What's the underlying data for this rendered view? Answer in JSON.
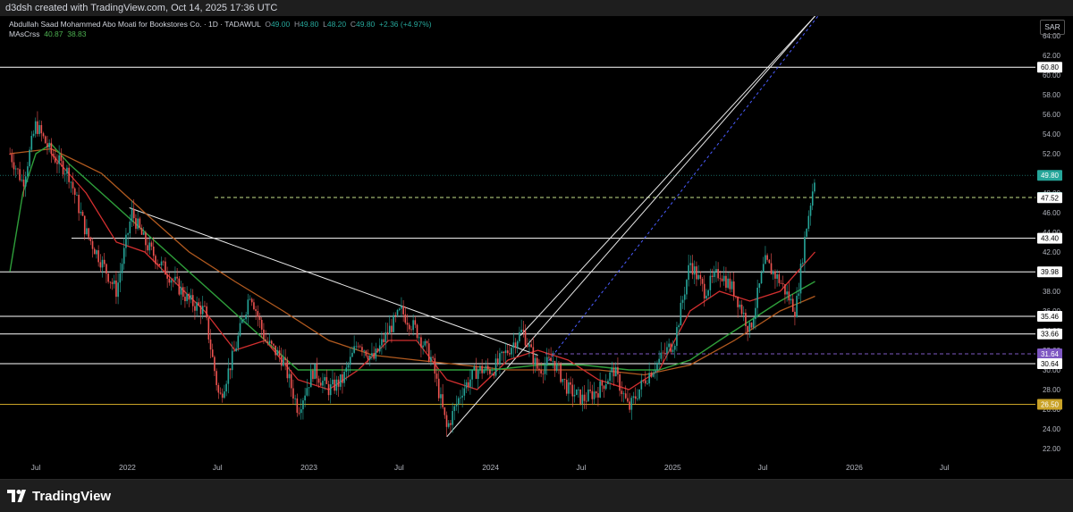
{
  "header": {
    "text": "d3dsh created with TradingView.com, Oct 14, 2025 17:36 UTC"
  },
  "symbol": {
    "name": "Abdullah Saad Mohammed Abo Moati for Bookstores Co. · 1D · TADAWUL",
    "open_label": "O",
    "open": "49.00",
    "high_label": "H",
    "high": "49.80",
    "low_label": "L",
    "low": "48.20",
    "close_label": "C",
    "close": "49.80",
    "change": "+2.36 (+4.97%)"
  },
  "indicator": {
    "name": "MAsCrss",
    "value1": "40.87",
    "value2": "38.83"
  },
  "currency": "SAR",
  "footer": {
    "brand": "TradingView"
  },
  "colors": {
    "up": "#26a69a",
    "down": "#ef5350",
    "ma_slow": "#b25a1f",
    "ma_red": "#d32f2f",
    "ma_green": "#2e9e3a",
    "level_line": "#ffffff",
    "purple": "#7e57c2",
    "yellow": "#c9a227",
    "teal": "#26a69a"
  },
  "chart_data": {
    "type": "line",
    "y_range": [
      21,
      66
    ],
    "y_ticks": [
      "22.00",
      "24.00",
      "26.00",
      "28.00",
      "30.00",
      "32.00",
      "34.00",
      "36.00",
      "38.00",
      "40.00",
      "42.00",
      "44.00",
      "46.00",
      "48.00",
      "50.00",
      "52.00",
      "54.00",
      "56.00",
      "58.00",
      "60.00",
      "62.00",
      "64.00"
    ],
    "x_ticks": [
      "Jul",
      "2022",
      "Jul",
      "2023",
      "Jul",
      "2024",
      "Jul",
      "2025",
      "Jul",
      "2026",
      "Jul"
    ],
    "price_series": {
      "name": "price",
      "x": [
        "2021-05-10",
        "2021-06-05",
        "2021-07-01",
        "2021-08-01",
        "2021-09-05",
        "2021-10-10",
        "2021-11-10",
        "2021-12-10",
        "2022-01-10",
        "2022-02-05",
        "2022-03-05",
        "2022-04-05",
        "2022-05-05",
        "2022-06-05",
        "2022-07-05",
        "2022-08-05",
        "2022-09-05",
        "2022-10-05",
        "2022-11-10",
        "2022-12-10",
        "2023-01-10",
        "2023-02-10",
        "2023-03-10",
        "2023-04-10",
        "2023-05-10",
        "2023-06-10",
        "2023-07-05",
        "2023-08-05",
        "2023-09-05",
        "2023-10-05",
        "2023-11-05",
        "2023-12-05",
        "2024-01-05",
        "2024-02-05",
        "2024-03-05",
        "2024-04-05",
        "2024-05-05",
        "2024-06-05",
        "2024-07-05",
        "2024-08-05",
        "2024-09-05",
        "2024-10-05",
        "2024-11-05",
        "2024-12-05",
        "2025-01-05",
        "2025-02-05",
        "2025-03-05",
        "2025-04-05",
        "2025-05-05",
        "2025-06-05",
        "2025-07-05",
        "2025-08-05",
        "2025-09-05",
        "2025-09-25",
        "2025-10-14"
      ],
      "y": [
        52,
        49,
        55,
        52,
        50,
        44,
        41,
        38,
        46,
        43,
        41,
        39,
        37,
        36,
        27,
        32,
        38,
        33,
        31,
        26,
        30,
        28,
        29,
        33,
        31,
        34,
        36,
        34,
        31,
        24,
        28,
        30,
        30,
        32,
        34,
        30,
        31,
        28,
        27,
        28,
        30,
        26,
        29,
        31,
        33,
        41,
        38,
        40,
        38,
        34,
        41,
        39,
        36,
        44,
        49.8
      ]
    },
    "ma_slow": {
      "name": "",
      "x": [
        "2021-05-10",
        "2021-08-01",
        "2021-11-10",
        "2022-02-05",
        "2022-05-05",
        "2022-08-05",
        "2022-11-10",
        "2023-02-10",
        "2023-05-10",
        "2023-08-05",
        "2023-11-05",
        "2024-02-05",
        "2024-05-05",
        "2024-08-05",
        "2024-11-05",
        "2025-02-05",
        "2025-05-05",
        "2025-08-05",
        "2025-10-14"
      ],
      "y": [
        52,
        52.5,
        50,
        46,
        42,
        39,
        36,
        33,
        31.5,
        31,
        30.5,
        30,
        30,
        30,
        29.5,
        30.5,
        33,
        36,
        37.5
      ]
    },
    "ma_red": {
      "name": "",
      "x": [
        "2021-08-01",
        "2021-10-10",
        "2021-12-10",
        "2022-02-05",
        "2022-04-05",
        "2022-06-05",
        "2022-08-05",
        "2022-10-05",
        "2022-12-10",
        "2023-02-10",
        "2023-04-10",
        "2023-06-10",
        "2023-08-05",
        "2023-10-05",
        "2023-12-05",
        "2024-02-05",
        "2024-04-05",
        "2024-06-05",
        "2024-08-05",
        "2024-10-05",
        "2024-12-05",
        "2025-02-05",
        "2025-04-05",
        "2025-06-05",
        "2025-08-05",
        "2025-10-14"
      ],
      "y": [
        52,
        48,
        43,
        42,
        39,
        36,
        32,
        33,
        29,
        28,
        30,
        33,
        33,
        29,
        28,
        31,
        32,
        31,
        29,
        28,
        30,
        36,
        38,
        37,
        38,
        42
      ]
    },
    "ma_green": {
      "name": "",
      "x": [
        "2021-05-10",
        "2021-06-05",
        "2021-07-01",
        "2021-08-01",
        "2021-09-05",
        "2022-12-10",
        "2023-03-10",
        "2023-06-10",
        "2023-08-05",
        "2023-10-05",
        "2024-01-05",
        "2024-04-05",
        "2024-07-05",
        "2024-10-05",
        "2024-12-05",
        "2025-02-05",
        "2025-04-05",
        "2025-06-05",
        "2025-08-05",
        "2025-10-14"
      ],
      "y": [
        40,
        48,
        52,
        53,
        51,
        30,
        30,
        30,
        30,
        30,
        30,
        30.5,
        30.5,
        30,
        30,
        31,
        33,
        35,
        37,
        39
      ]
    },
    "horizontal_levels": [
      {
        "value": 60.8,
        "label": "60.80",
        "color": "#ffffff"
      },
      {
        "value": 49.8,
        "label": "49.80",
        "color": "#26a69a"
      },
      {
        "value": 47.54,
        "label": "47.54",
        "color": "#26a69a"
      },
      {
        "value": 47.52,
        "label": "47.52",
        "color": "#ffffff"
      },
      {
        "value": 43.4,
        "label": "43.40",
        "color": "#ffffff"
      },
      {
        "value": 39.98,
        "label": "39.98",
        "color": "#ffffff"
      },
      {
        "value": 35.46,
        "label": "35.46",
        "color": "#ffffff"
      },
      {
        "value": 33.66,
        "label": "33.66",
        "color": "#ffffff"
      },
      {
        "value": 31.64,
        "label": "31.64",
        "color": "#7e57c2"
      },
      {
        "value": 30.64,
        "label": "30.64",
        "color": "#ffffff"
      },
      {
        "value": 26.5,
        "label": "26.50",
        "color": "#c9a227"
      }
    ],
    "trendlines": [
      {
        "x": [
          "2022-01-05",
          "2024-04-05"
        ],
        "y": [
          46.5,
          31.5
        ]
      },
      {
        "x": [
          "2023-10-05",
          "2025-10-14"
        ],
        "y": [
          23.2,
          66
        ]
      },
      {
        "x": [
          "2024-03-01",
          "2025-10-14"
        ],
        "y": [
          33.5,
          66
        ]
      }
    ],
    "grid": false,
    "ylabel": "",
    "xlabel": "",
    "title": ""
  }
}
